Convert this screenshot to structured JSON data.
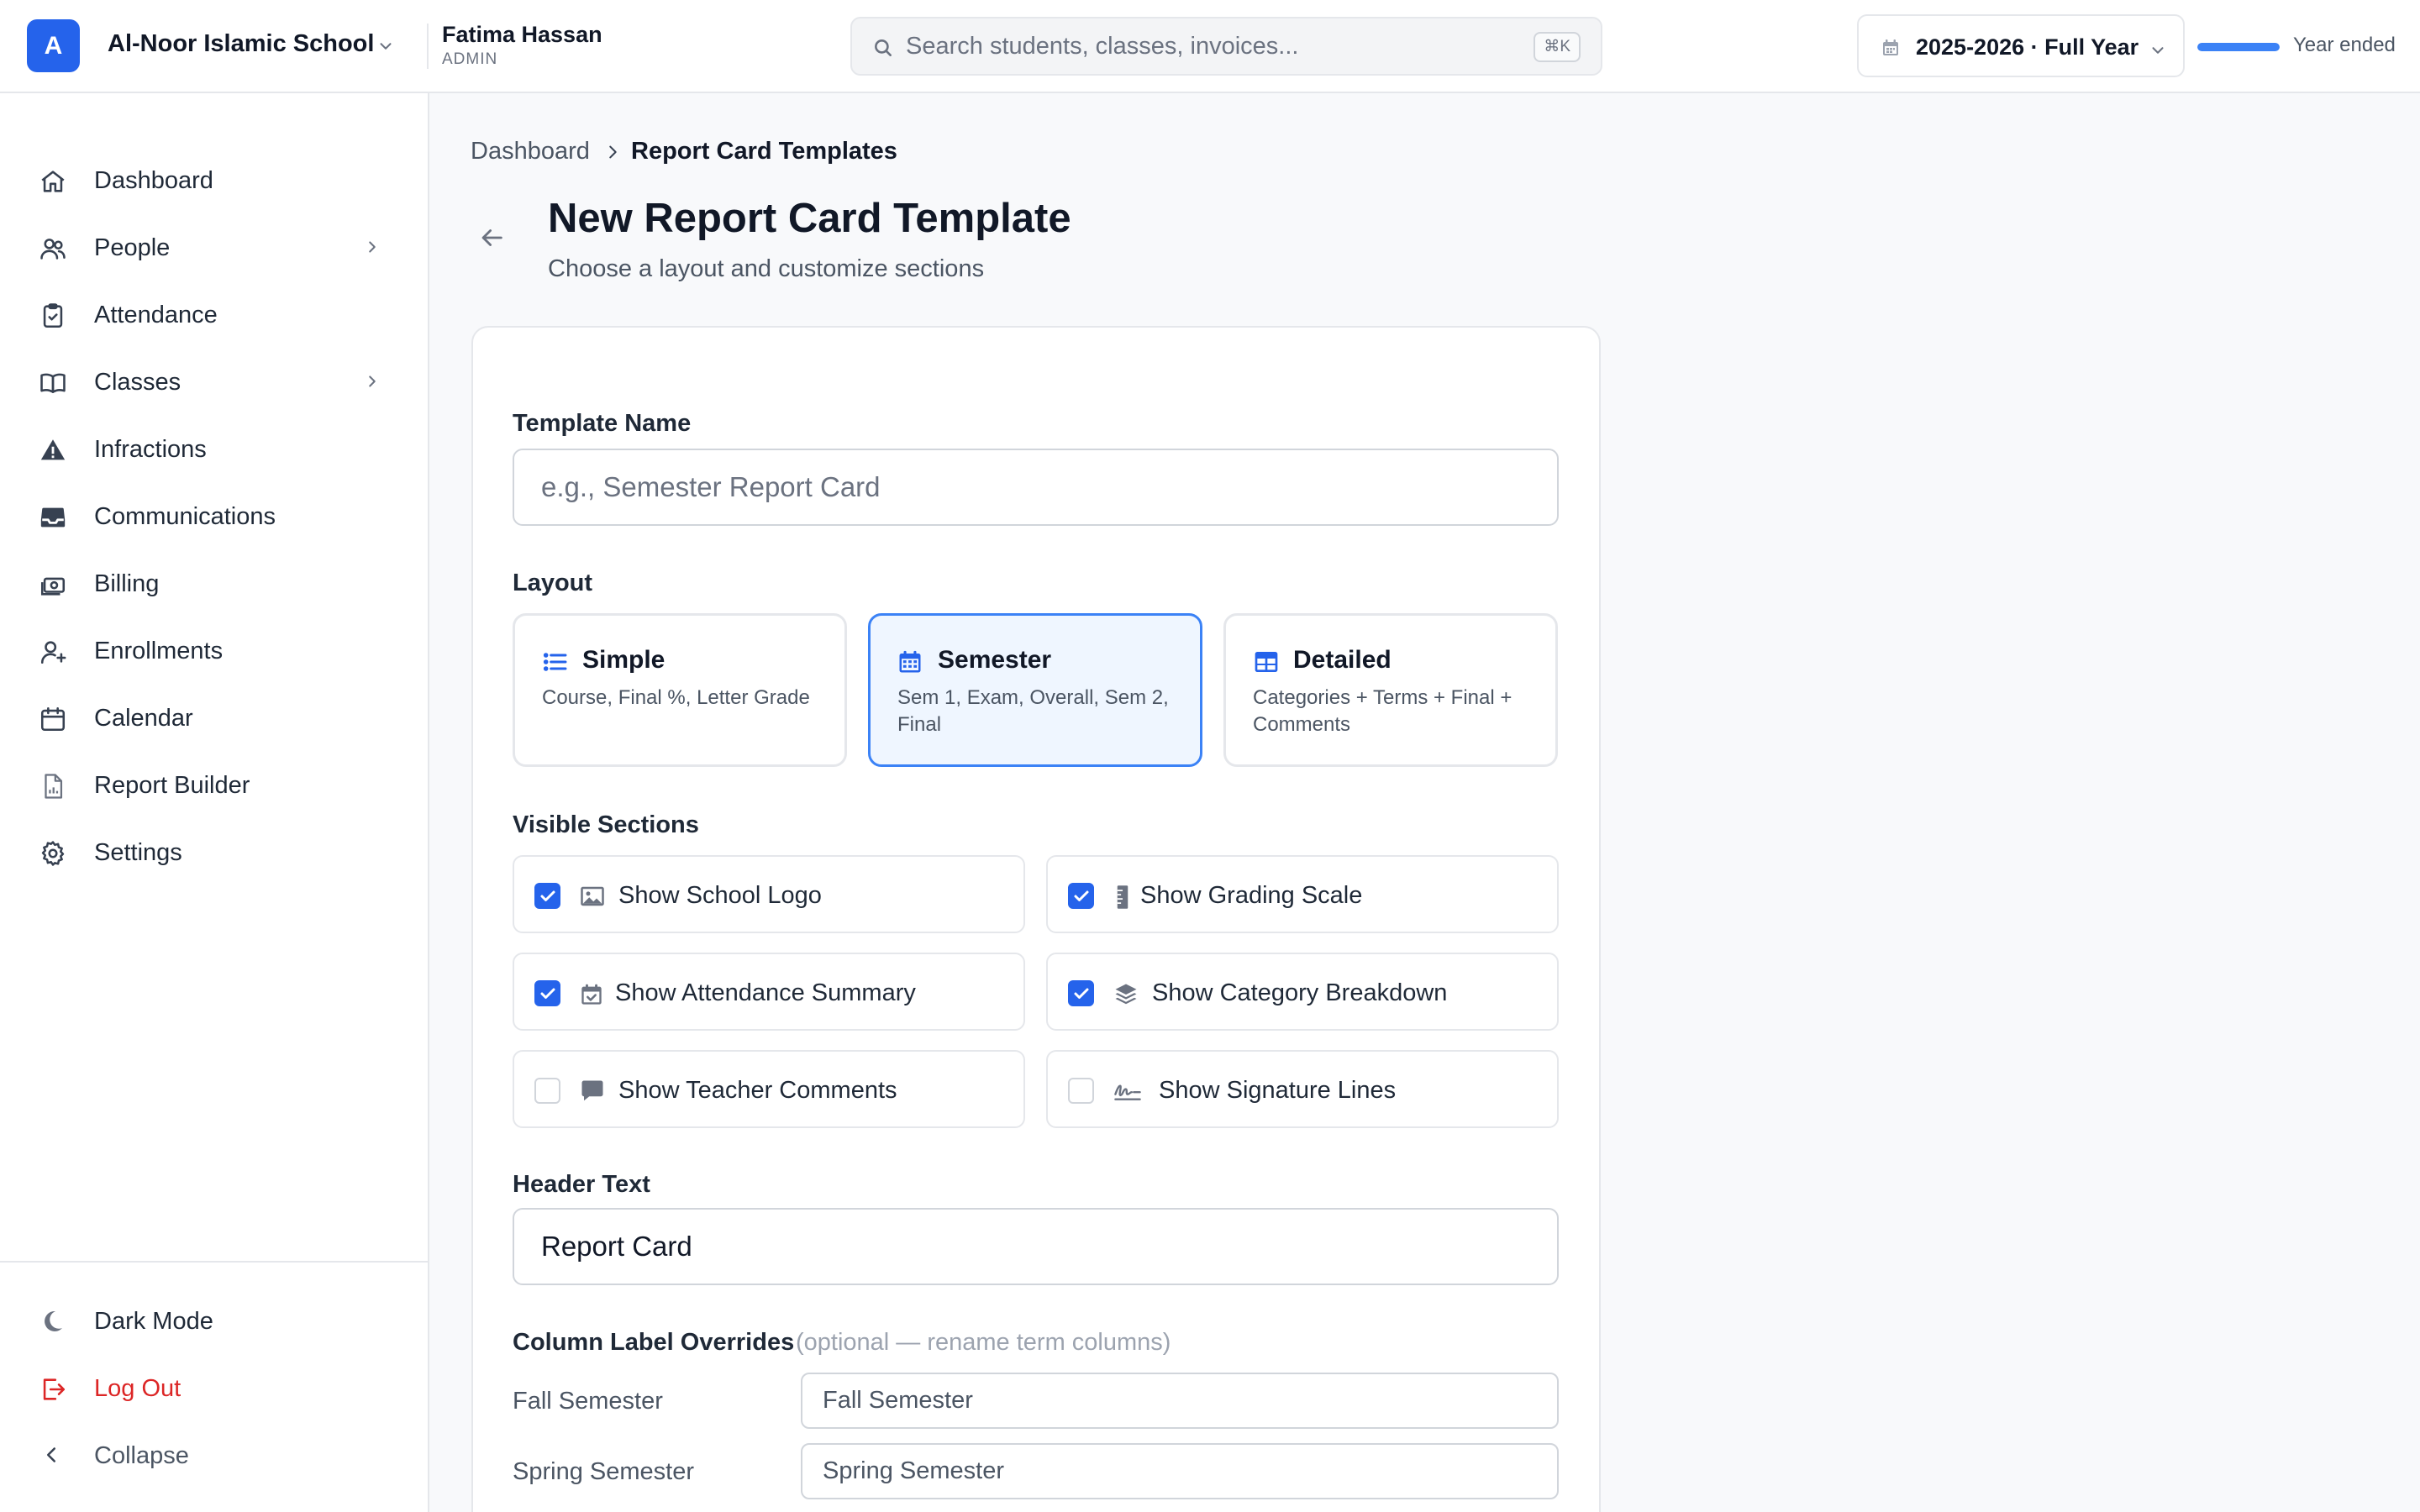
{
  "header": {
    "logo_letter": "A",
    "school_name": "Al-Noor Islamic School",
    "user_name": "Fatima Hassan",
    "user_role": "ADMIN",
    "search_placeholder": "Search students, classes, invoices...",
    "search_shortcut": "⌘K",
    "year_label": "2025-2026 · Full Year",
    "year_progress": 1.0,
    "year_status": "Year ended"
  },
  "sidebar": {
    "items": [
      {
        "label": "Dashboard",
        "icon": "home-icon"
      },
      {
        "label": "People",
        "icon": "users-icon"
      },
      {
        "label": "Attendance",
        "icon": "clipboard-check-icon"
      },
      {
        "label": "Classes",
        "icon": "book-open-icon"
      },
      {
        "label": "Infractions",
        "icon": "warning-icon"
      },
      {
        "label": "Communications",
        "icon": "inbox-icon"
      },
      {
        "label": "Billing",
        "icon": "cash-icon"
      },
      {
        "label": "Enrollments",
        "icon": "user-plus-icon"
      },
      {
        "label": "Calendar",
        "icon": "calendar-icon"
      },
      {
        "label": "Report Builder",
        "icon": "document-chart-icon"
      },
      {
        "label": "Settings",
        "icon": "gear-icon"
      }
    ],
    "footer": {
      "dark_mode": "Dark Mode",
      "logout": "Log Out",
      "collapse": "Collapse"
    }
  },
  "breadcrumb": {
    "root": "Dashboard",
    "current": "Report Card Templates"
  },
  "page": {
    "title": "New Report Card Template",
    "subtitle": "Choose a layout and customize sections"
  },
  "form": {
    "template_name": {
      "label": "Template Name",
      "placeholder": "e.g., Semester Report Card",
      "value": ""
    },
    "layout": {
      "label": "Layout",
      "selected": "Semester",
      "options": [
        {
          "title": "Simple",
          "desc": "Course, Final %, Letter Grade",
          "icon": "list-icon"
        },
        {
          "title": "Semester",
          "desc": "Sem 1, Exam, Overall, Sem 2, Final",
          "icon": "calendar-icon"
        },
        {
          "title": "Detailed",
          "desc": "Categories + Terms + Final + Comments",
          "icon": "table-icon"
        }
      ]
    },
    "visible_sections": {
      "label": "Visible Sections",
      "items": [
        {
          "label": "Show School Logo",
          "checked": true,
          "icon": "image-icon"
        },
        {
          "label": "Show Grading Scale",
          "checked": true,
          "icon": "ruler-icon"
        },
        {
          "label": "Show Attendance Summary",
          "checked": true,
          "icon": "calendar-check-icon"
        },
        {
          "label": "Show Category Breakdown",
          "checked": true,
          "icon": "layers-icon"
        },
        {
          "label": "Show Teacher Comments",
          "checked": false,
          "icon": "comment-icon"
        },
        {
          "label": "Show Signature Lines",
          "checked": false,
          "icon": "signature-icon"
        }
      ]
    },
    "header_text": {
      "label": "Header Text",
      "value": "Report Card"
    },
    "column_overrides": {
      "label": "Column Label Overrides",
      "hint": "(optional — rename term columns)",
      "rows": [
        {
          "label": "Fall Semester",
          "placeholder": "Fall Semester"
        },
        {
          "label": "Spring Semester",
          "placeholder": "Spring Semester"
        }
      ]
    }
  },
  "colors": {
    "accent": "#2563eb",
    "selected_bg": "#eff6ff",
    "danger": "#dc2626"
  }
}
